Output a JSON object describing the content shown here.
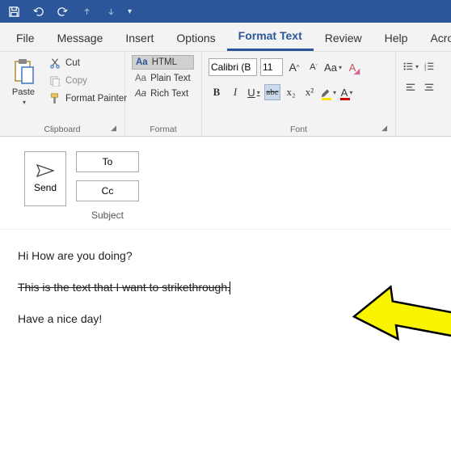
{
  "tabs": [
    "File",
    "Message",
    "Insert",
    "Options",
    "Format Text",
    "Review",
    "Help",
    "Acroba"
  ],
  "active_tab": 4,
  "ribbon": {
    "clipboard": {
      "paste": "Paste",
      "cut": "Cut",
      "copy": "Copy",
      "fp": "Format Painter",
      "label": "Clipboard"
    },
    "format": {
      "html": "HTML",
      "plain": "Plain Text",
      "rich": "Rich Text",
      "aa": "Aa",
      "label": "Format"
    },
    "font": {
      "name": "Calibri (B",
      "size": "11",
      "grow": "A",
      "shrink": "A",
      "case": "Aa",
      "clear": "A",
      "bold": "B",
      "italic": "I",
      "under": "U",
      "strike": "abc",
      "sub": "x₂",
      "sup": "x²",
      "hl_a": "A",
      "fc_a": "A",
      "label": "Font"
    }
  },
  "mail": {
    "send": "Send",
    "to": "To",
    "cc": "Cc",
    "subject": "Subject"
  },
  "body": {
    "line1": "Hi How are you doing?",
    "line2": "This is the text that I want to strikethrough.",
    "line3": "Have a nice day!"
  }
}
